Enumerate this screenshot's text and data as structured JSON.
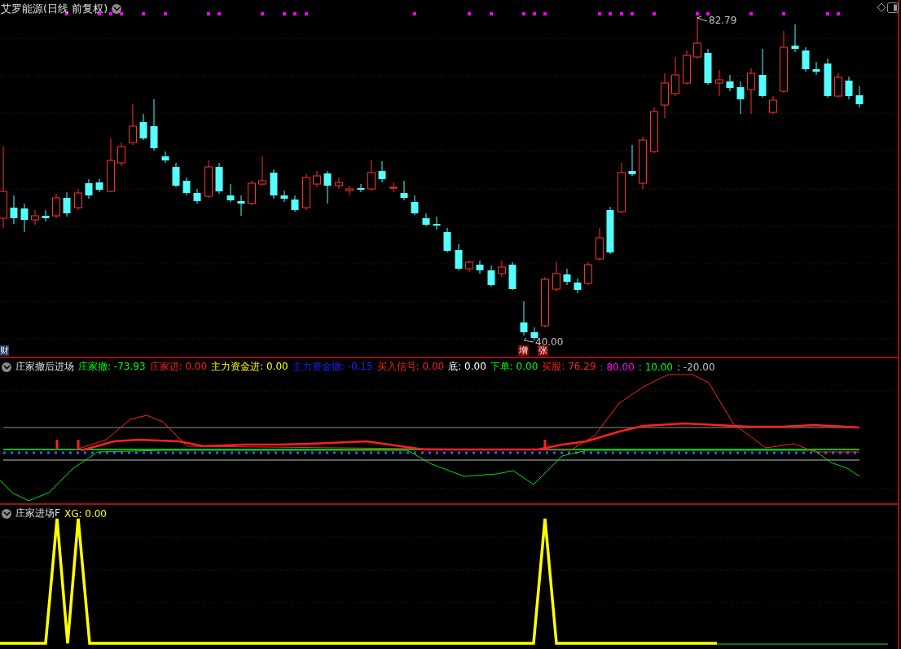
{
  "window": {
    "title": "艾罗能源(日线 前复权)"
  },
  "main_chart": {
    "kind": "picture",
    "high_label": "82.79",
    "low_label": "40.00",
    "markers": [
      "增",
      "张"
    ],
    "corner_tag": "财"
  },
  "indicators": [
    {
      "name": "庄家撤后进场",
      "values": [
        {
          "text": "庄家撤: -73.93",
          "color": "#00ff00"
        },
        {
          "text": "庄家进: 0.00",
          "color": "#ff2020"
        },
        {
          "text": "主力资金进: 0.00",
          "color": "#ffff00"
        },
        {
          "text": "主力资金撤: -0.15",
          "color": "#2020ff"
        },
        {
          "text": "买入信号: 0.00",
          "color": "#ff2020"
        },
        {
          "text": "底: 0.00",
          "color": "#ffffff"
        },
        {
          "text": "下单: 0.00",
          "color": "#00ff00"
        },
        {
          "text": "买股: 76.29",
          "color": "#ff2020"
        },
        {
          "text": ": 80.00",
          "color": "#ff00ff"
        },
        {
          "text": ": 10.00",
          "color": "#00ff00"
        },
        {
          "text": ": -20.00",
          "color": "#c0c0c0"
        }
      ]
    },
    {
      "name": "庄家进场F",
      "values": [
        {
          "text": "XG: 0.00",
          "color": "#ffff00"
        }
      ]
    }
  ]
}
